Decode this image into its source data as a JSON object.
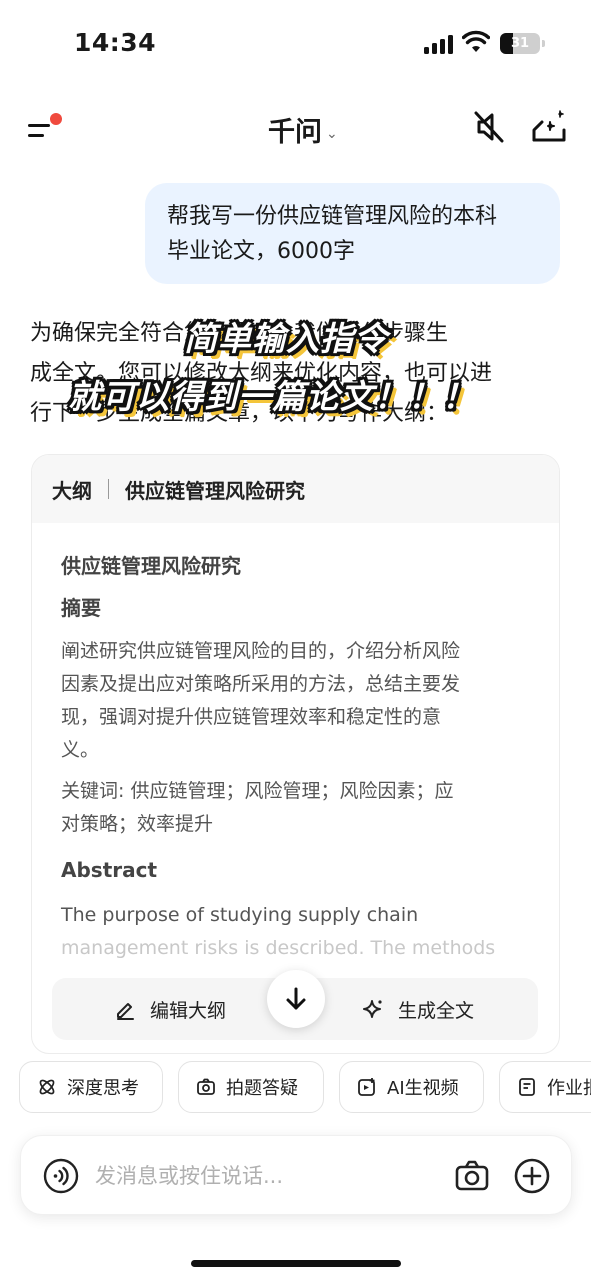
{
  "status_bar": {
    "time": "14:34",
    "battery": "31"
  },
  "nav": {
    "title": "千问",
    "chevron": "⌄"
  },
  "user_message": {
    "line1": "帮我写一份供应链管理风险的本科",
    "line2": "毕业论文，6000字"
  },
  "ai_reply": {
    "line1": "为确保完全符合您的要求，我们会分步骤生",
    "line2": "成全文。您可以修改大纲来优化内容，也可以进",
    "line3": "行下一步生成全篇文章，以下为写作大纲："
  },
  "overlay_caption": {
    "line1": "简单输入指令",
    "line2": "就可以得到一篇论文！！！"
  },
  "outline_card": {
    "tag": "大纲",
    "heading": "供应链管理风险研究",
    "title": "供应链管理风险研究",
    "abstract_cn_label": "摘要",
    "abstract_cn_lines": [
      "阐述研究供应链管理风险的目的，介绍分析风险",
      "因素及提出应对策略所采用的方法，总结主要发",
      "现，强调对提升供应链管理效率和稳定性的意",
      "义。"
    ],
    "keywords_lines": [
      "关键词: 供应链管理；风险管理；风险因素；应",
      "对策略；效率提升"
    ],
    "abstract_en_label": "Abstract",
    "abstract_en_line1": "The purpose of studying supply chain",
    "abstract_en_line2": "management risks is described. The methods"
  },
  "actions": {
    "edit_outline": "编辑大纲",
    "generate_full": "生成全文"
  },
  "chips": [
    {
      "label": "深度思考",
      "icon": "atom-icon"
    },
    {
      "label": "拍题答疑",
      "icon": "camera-icon"
    },
    {
      "label": "AI生视频",
      "icon": "video-plus-icon"
    },
    {
      "label": "作业批改",
      "icon": "document-icon"
    }
  ],
  "input": {
    "placeholder": "发消息或按住说话..."
  },
  "colors": {
    "accent_red": "#f04a3e",
    "user_bubble": "#eaf3ff",
    "overlay_shadow": "#f4c53a"
  }
}
